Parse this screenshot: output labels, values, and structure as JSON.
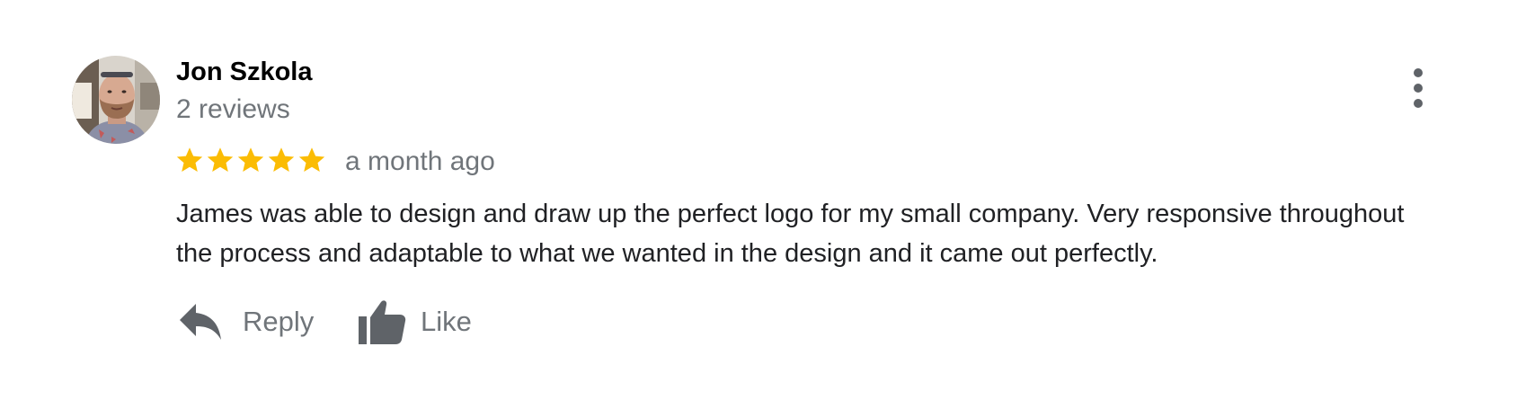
{
  "review": {
    "author": {
      "name": "Jon Szkola",
      "reviews_count": "2 reviews",
      "avatar_icon": "user-photo-avatar"
    },
    "rating": {
      "stars": 5,
      "max_stars": 5,
      "star_color": "#fbbc04"
    },
    "timestamp": "a month ago",
    "text": "James was able to design and draw up the perfect logo for my small company. Very responsive throughout the process and adaptable to what we wanted in the design and it came out perfectly.",
    "actions": {
      "reply_label": "Reply",
      "reply_icon": "reply-arrow-icon",
      "like_label": "Like",
      "like_icon": "thumbs-up-icon"
    },
    "more_icon": "more-vertical-icon"
  },
  "colors": {
    "text_primary": "#202124",
    "text_secondary": "#70757a",
    "icon_gray": "#5f6368"
  }
}
